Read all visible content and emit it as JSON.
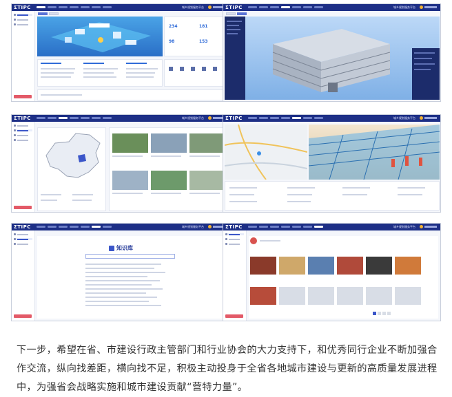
{
  "app": {
    "logo_text": "ΣTIPC",
    "tagline": "城乡规划服务平台"
  },
  "screens": [
    {
      "id": "dashboard",
      "icon": "dashboard-3d-map",
      "accent": "#2f6bd8",
      "stats": [
        "234",
        "181",
        "98",
        "153"
      ]
    },
    {
      "id": "bim-model",
      "icon": "building-3d-model",
      "accent": "#6fa8e8"
    },
    {
      "id": "project-map",
      "icon": "china-map",
      "accent": "#e6a23c"
    },
    {
      "id": "site-monitor",
      "icon": "city-map-and-photo",
      "accent": "#3a8ee6"
    },
    {
      "id": "knowledge-base",
      "icon": "search-portal",
      "accent": "#3b56c9",
      "title": "知识库"
    },
    {
      "id": "news-feed",
      "icon": "news-grid",
      "accent": "#d9534f"
    }
  ],
  "caption": "下一步，希望在省、市建设行政主管部门和行业协会的大力支持下，和优秀同行企业不断加强合作交流，纵向找差距，横向找不足，积极主动投身于全省各地城市建设与更新的高质量发展进程中，为强省会战略实施和城市建设贡献“营特力量”。",
  "colors": {
    "header": "#1d2f86",
    "side_button": "#e35a68",
    "text": "#333333"
  }
}
